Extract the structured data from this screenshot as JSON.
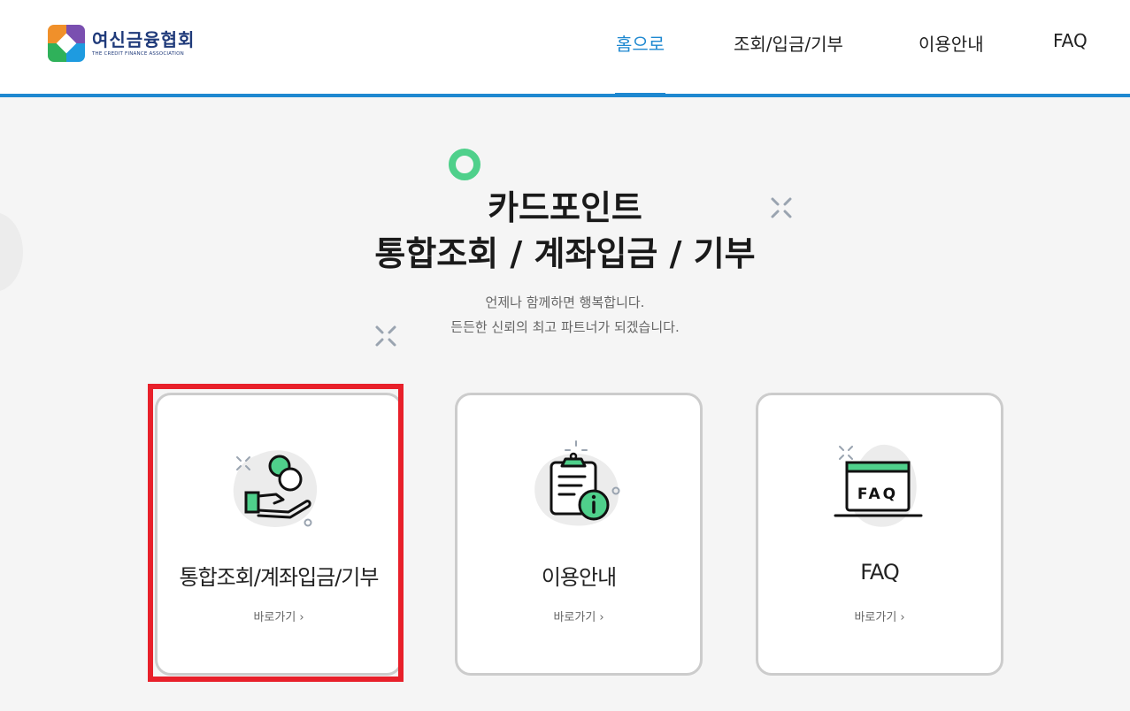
{
  "header": {
    "logo_text": "여신금융협회",
    "logo_subtext": "THE CREDIT FINANCE ASSOCIATION",
    "nav": [
      {
        "label": "홈으로",
        "active": true
      },
      {
        "label": "조회/입금/기부",
        "active": false
      },
      {
        "label": "이용안내",
        "active": false
      },
      {
        "label": "FAQ",
        "active": false
      }
    ]
  },
  "hero": {
    "title_line1": "카드포인트",
    "title_line2": "통합조회 / 계좌입금 / 기부",
    "subtitle_line1": "언제나 함께하면 행복합니다.",
    "subtitle_line2": "든든한 신뢰의 최고 파트너가 되겠습니다."
  },
  "cards": [
    {
      "title": "통합조회/계좌입금/기부",
      "link_label": "바로가기",
      "icon": "coin-hand-icon"
    },
    {
      "title": "이용안내",
      "link_label": "바로가기",
      "icon": "clipboard-info-icon"
    },
    {
      "title": "FAQ",
      "link_label": "바로가기",
      "icon": "faq-laptop-icon"
    }
  ],
  "colors": {
    "accent": "#1e88d0",
    "green": "#4fd08b",
    "highlight": "#e8202a"
  }
}
